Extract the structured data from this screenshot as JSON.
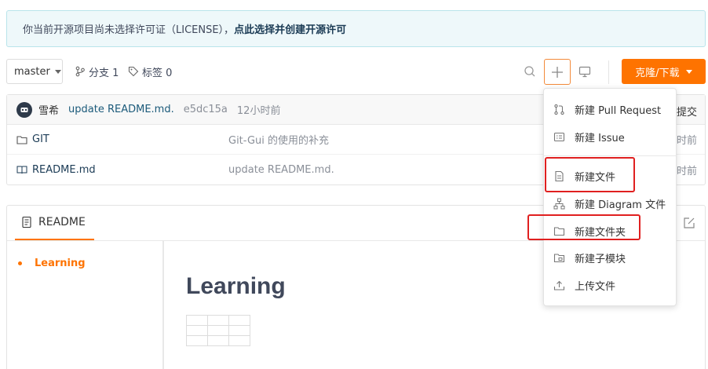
{
  "notice": {
    "text": "你当前开源项目尚未选择许可证（LICENSE），",
    "link": "点此选择并创建开源许可"
  },
  "toolbar": {
    "branch": "master",
    "branches_label": "分支 1",
    "tags_label": "标签 0",
    "clone_label": "克隆/下载"
  },
  "commit": {
    "author": "雪希",
    "message": "update README.md.",
    "sha": "e5dc15a",
    "time": "12小时前",
    "right_label": "提交"
  },
  "files": [
    {
      "name": "GIT",
      "type": "folder",
      "commit": "Git-Gui 的使用的补充",
      "time": "时前"
    },
    {
      "name": "README.md",
      "type": "file",
      "commit": "update README.md.",
      "time": "时前"
    }
  ],
  "readme": {
    "tab_label": "README",
    "toc": [
      "Learning"
    ],
    "title": "Learning"
  },
  "dropdown": {
    "items": [
      {
        "label": "新建 Pull Request",
        "icon": "pull-request-icon"
      },
      {
        "label": "新建 Issue",
        "icon": "issue-icon"
      },
      {
        "label": "新建文件",
        "icon": "file-icon"
      },
      {
        "label": "新建 Diagram 文件",
        "icon": "diagram-icon"
      },
      {
        "label": "新建文件夹",
        "icon": "folder-icon"
      },
      {
        "label": "新建子模块",
        "icon": "submodule-icon"
      },
      {
        "label": "上传文件",
        "icon": "upload-icon"
      }
    ]
  },
  "colors": {
    "accent": "#fe7300",
    "highlight": "#e02020",
    "notice_bg": "#eef8fa"
  }
}
